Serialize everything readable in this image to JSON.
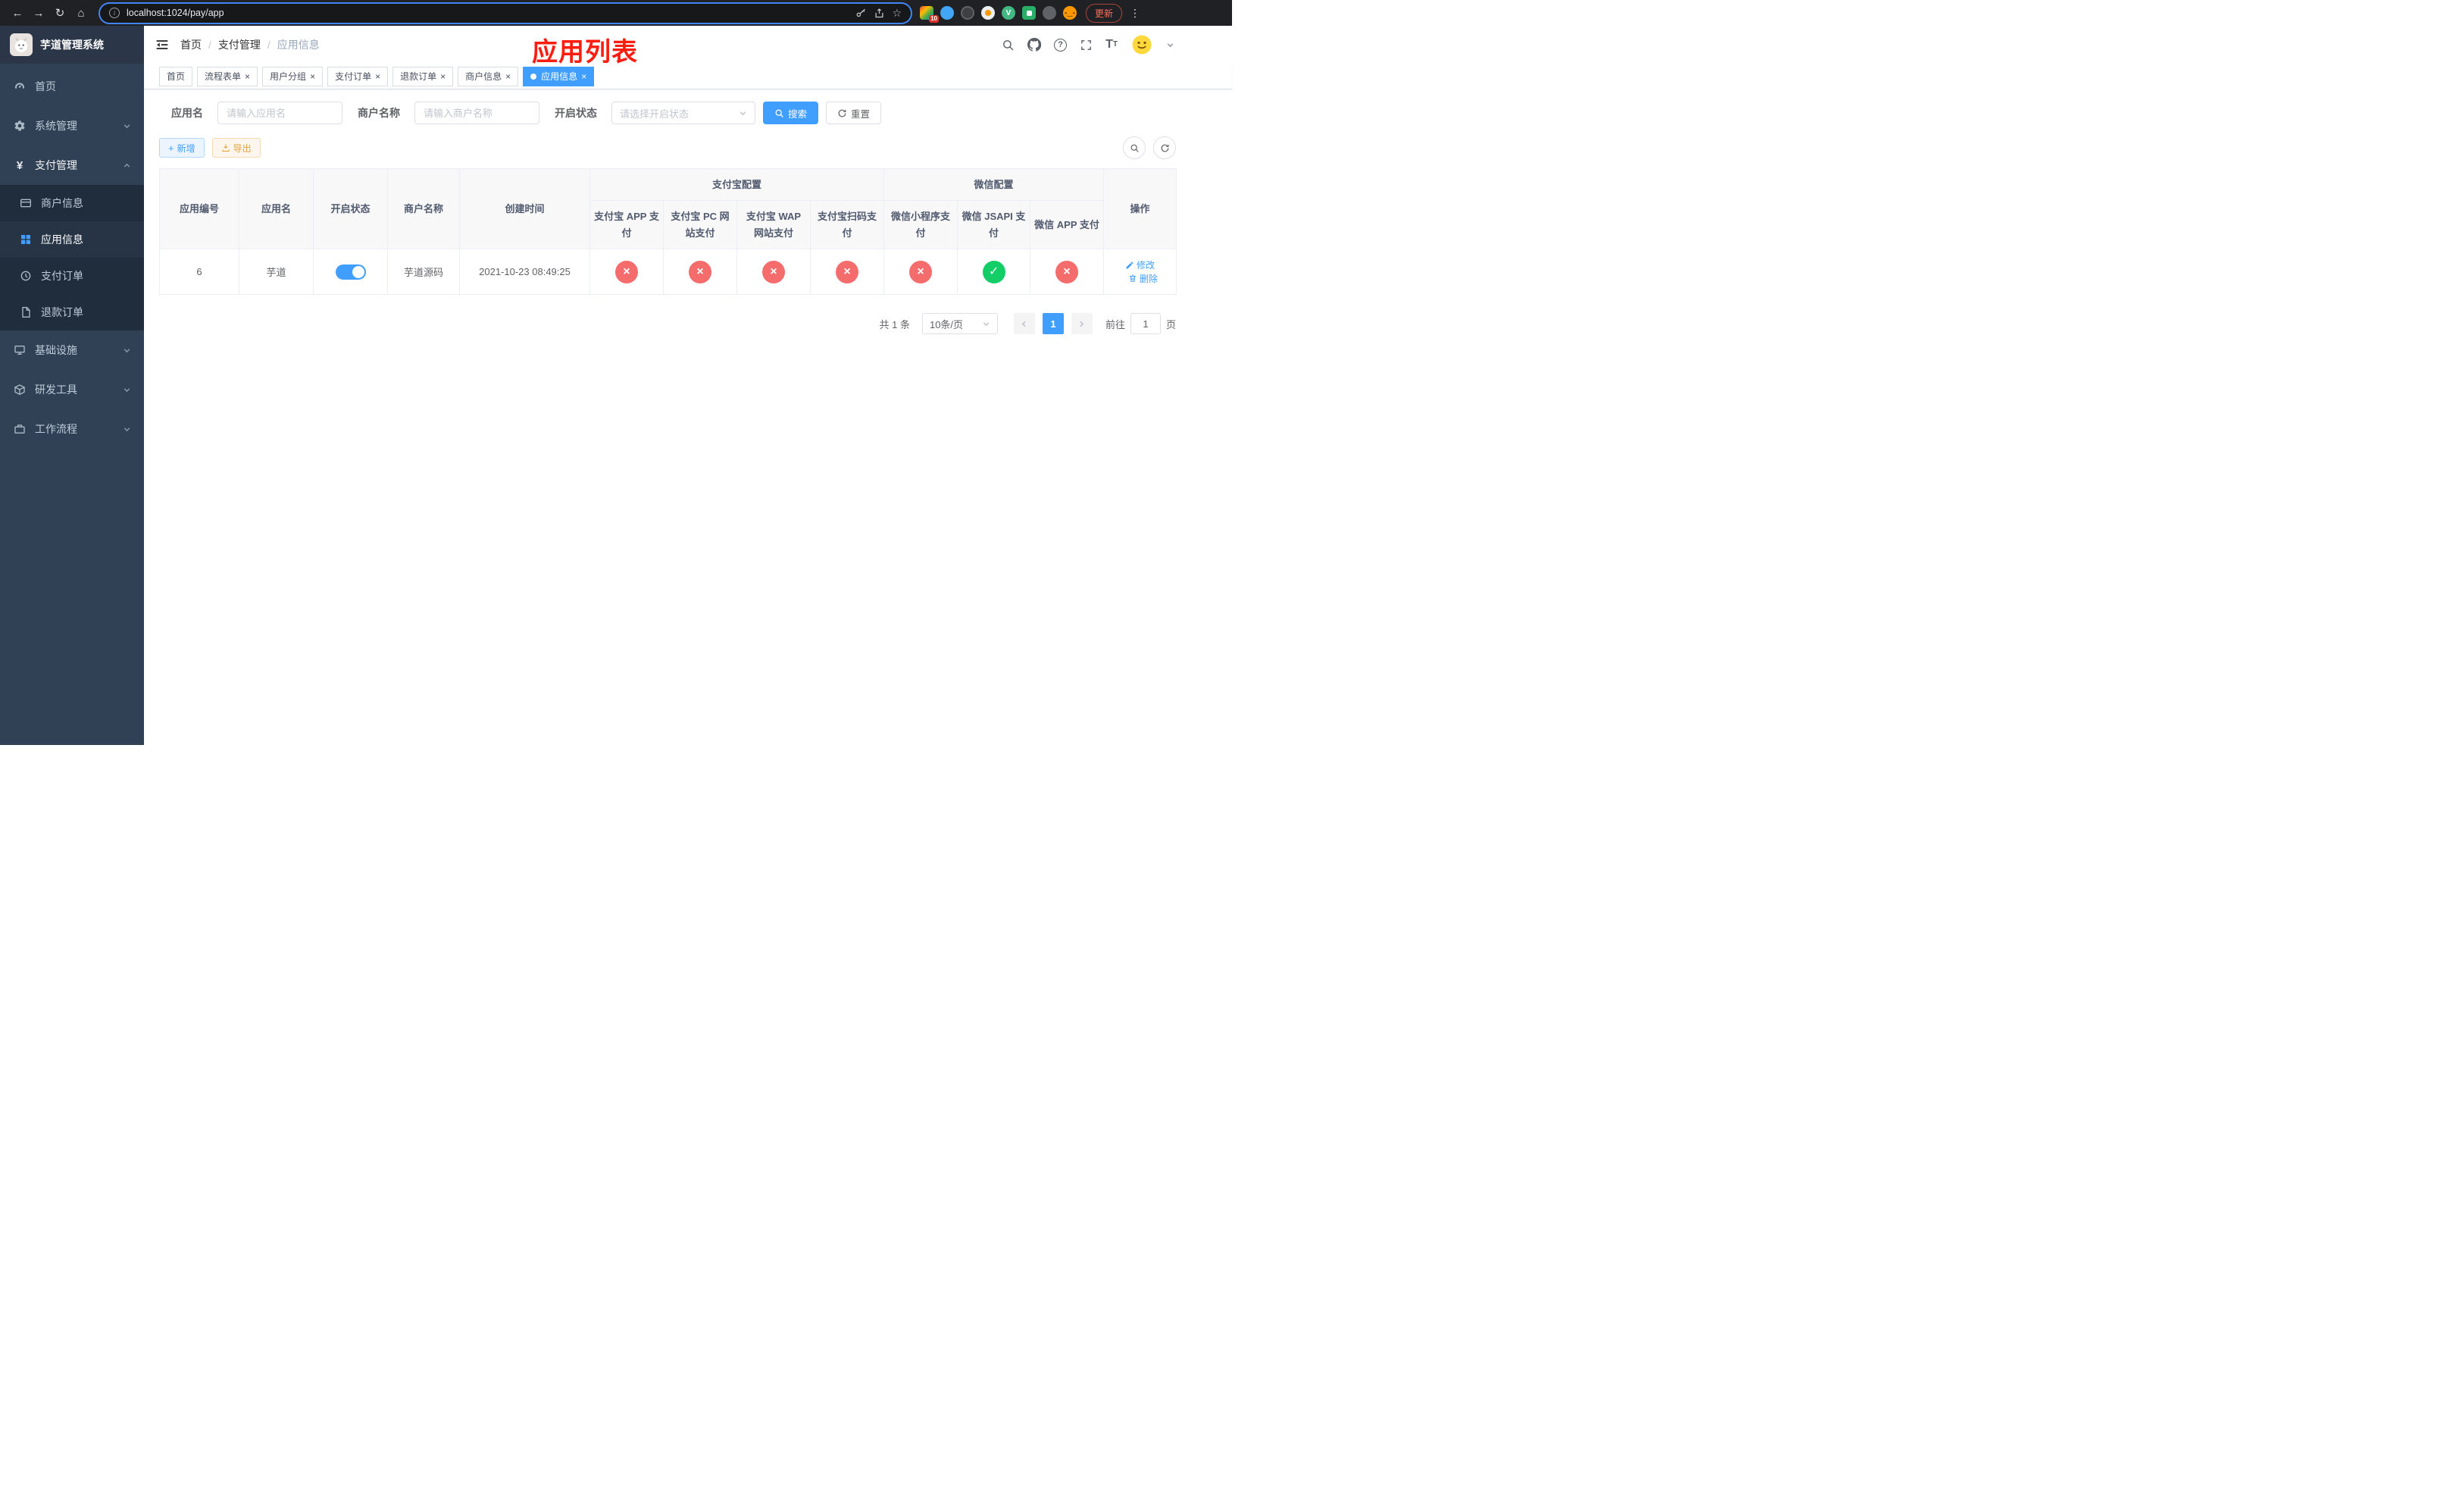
{
  "browser": {
    "url": "localhost:1024/pay/app",
    "update_button": "更新",
    "extension_badge": "10"
  },
  "app": {
    "logo_title": "芋道管理系统"
  },
  "sidebar": {
    "home": "首页",
    "system": "系统管理",
    "pay": "支付管理",
    "merchant": "商户信息",
    "appinfo": "应用信息",
    "payorder": "支付订单",
    "refund": "退款订单",
    "infra": "基础设施",
    "devtool": "研发工具",
    "workflow": "工作流程"
  },
  "breadcrumb": {
    "home": "首页",
    "section": "支付管理",
    "current": "应用信息"
  },
  "overlay_title": "应用列表",
  "tabs": [
    {
      "label": "首页"
    },
    {
      "label": "流程表单"
    },
    {
      "label": "用户分组"
    },
    {
      "label": "支付订单"
    },
    {
      "label": "退款订单"
    },
    {
      "label": "商户信息"
    },
    {
      "label": "应用信息"
    }
  ],
  "filters": {
    "app_name_label": "应用名",
    "app_name_placeholder": "请输入应用名",
    "merchant_label": "商户名称",
    "merchant_placeholder": "请输入商户名称",
    "status_label": "开启状态",
    "status_placeholder": "请选择开启状态",
    "search": "搜索",
    "reset": "重置"
  },
  "toolbar": {
    "add": "新增",
    "export": "导出"
  },
  "table": {
    "col_id": "应用编号",
    "col_name": "应用名",
    "col_status": "开启状态",
    "col_merchant": "商户名称",
    "col_created": "创建时间",
    "group_alipay": "支付宝配置",
    "group_wechat": "微信配置",
    "col_ops": "操作",
    "sub_cols": [
      "支付宝 APP 支付",
      "支付宝 PC 网站支付",
      "支付宝 WAP 网站支付",
      "支付宝扫码支付",
      "微信小程序支付",
      "微信 JSAPI 支付",
      "微信 APP 支付"
    ],
    "row": {
      "id": "6",
      "name": "芋道",
      "enabled": true,
      "merchant": "芋道源码",
      "created": "2021-10-23 08:49:25",
      "statuses": [
        false,
        false,
        false,
        false,
        false,
        true,
        false
      ],
      "edit": "修改",
      "delete": "删除"
    }
  },
  "pagination": {
    "total": "共 1 条",
    "size": "10条/页",
    "page": "1",
    "goto": "前往",
    "goto_value": "1",
    "unit": "页"
  },
  "colors": {
    "primary": "#409eff",
    "success": "#13ce66",
    "danger": "#f56c6c",
    "warning": "#e6a23c",
    "sidebar_bg": "#304156",
    "annotation_red": "#fb1d10"
  }
}
